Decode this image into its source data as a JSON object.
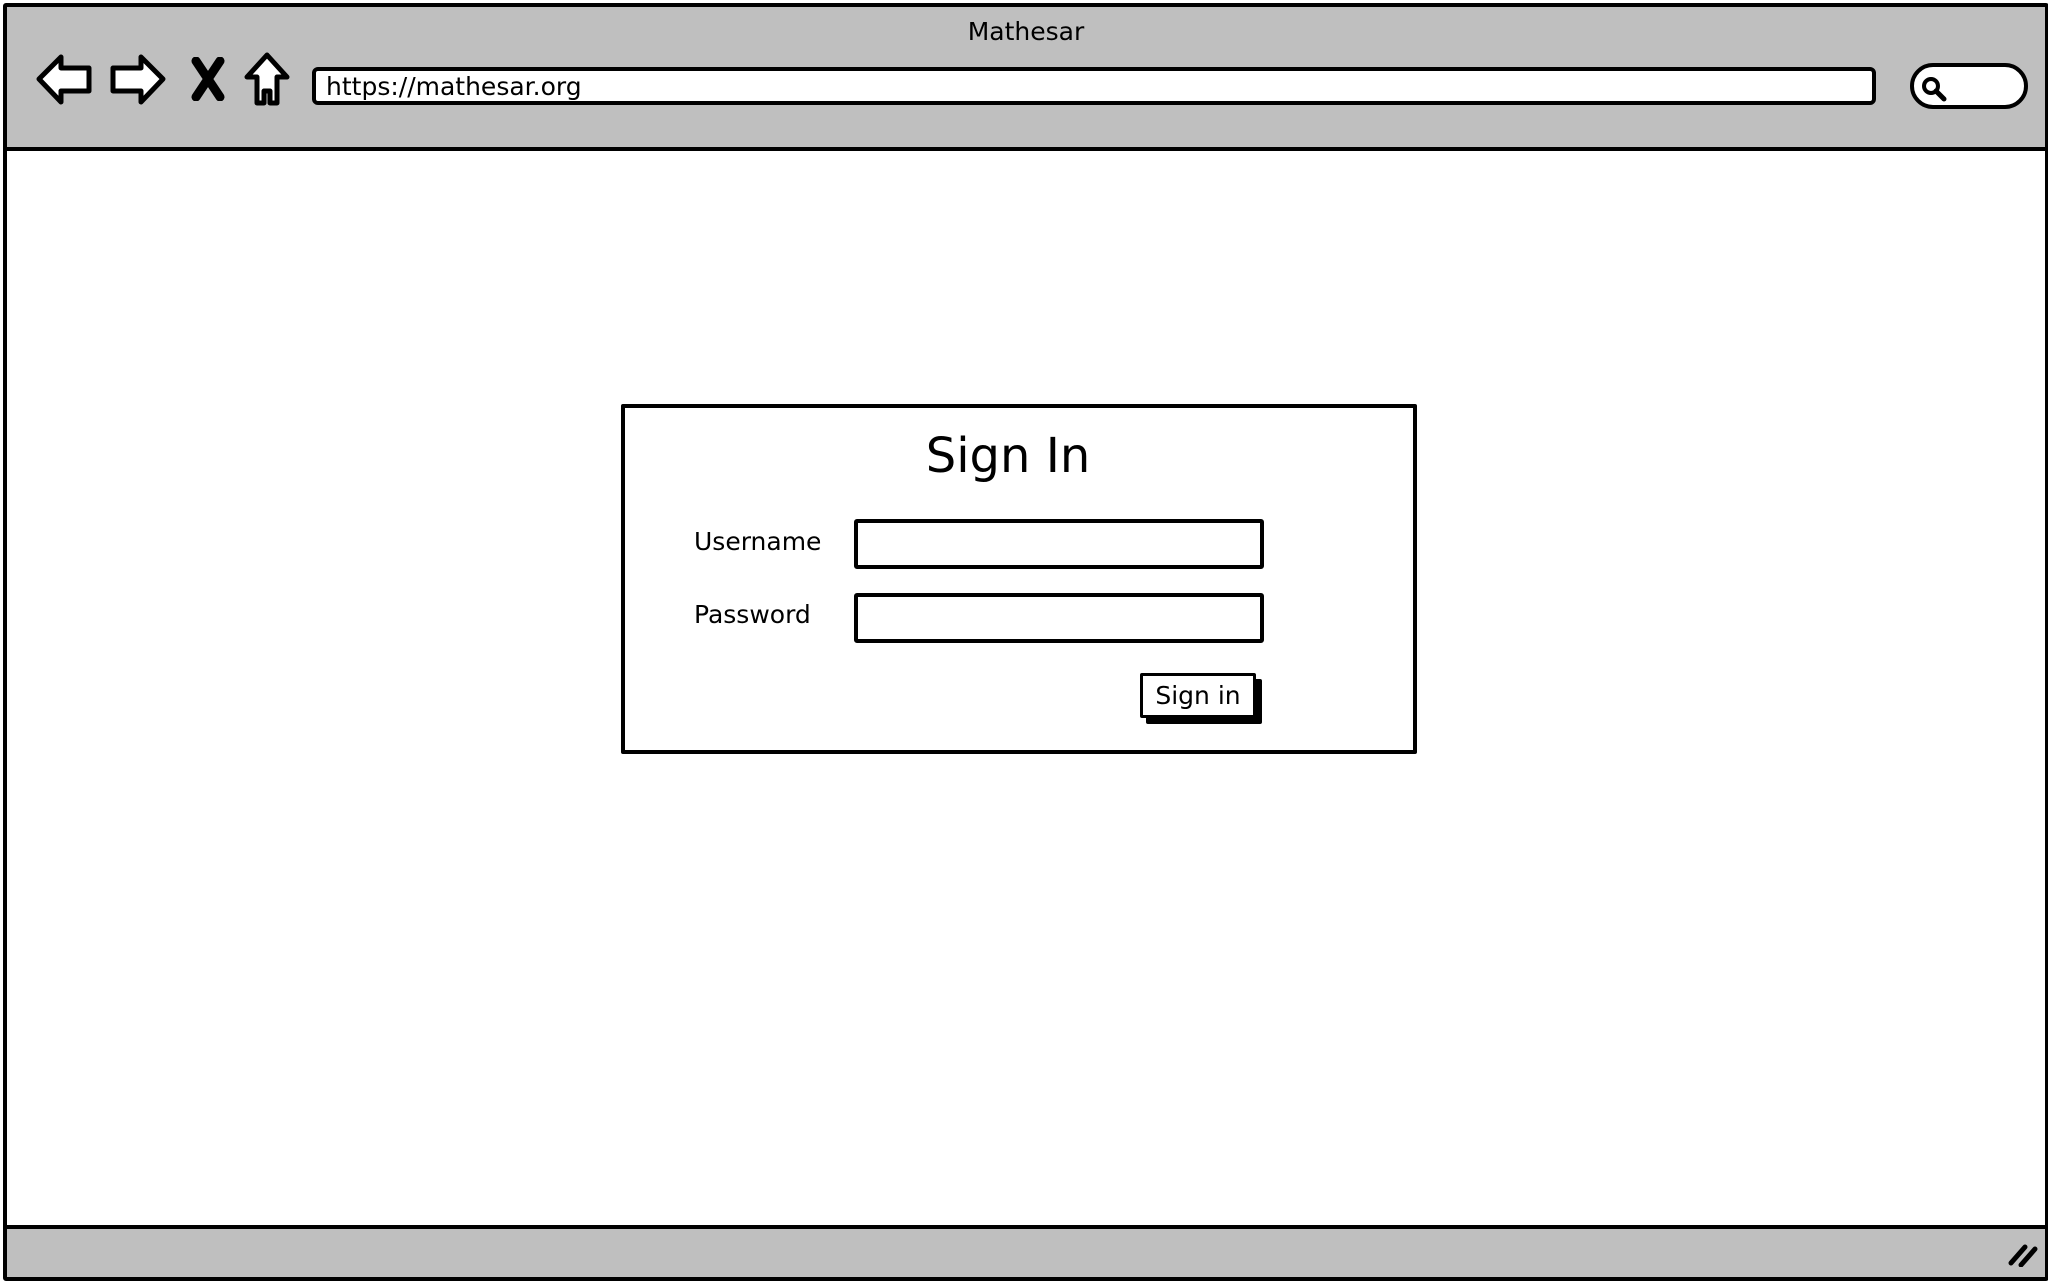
{
  "window": {
    "title": "Mathesar"
  },
  "toolbar": {
    "back_icon": "back-arrow-icon",
    "forward_icon": "forward-arrow-icon",
    "stop_icon": "close-x-icon",
    "home_icon": "home-icon",
    "url": "https://mathesar.org",
    "search_icon": "search-icon"
  },
  "signin": {
    "title": "Sign In",
    "username_label": "Username",
    "username_value": "",
    "password_label": "Password",
    "password_value": "",
    "submit_label": "Sign in"
  }
}
